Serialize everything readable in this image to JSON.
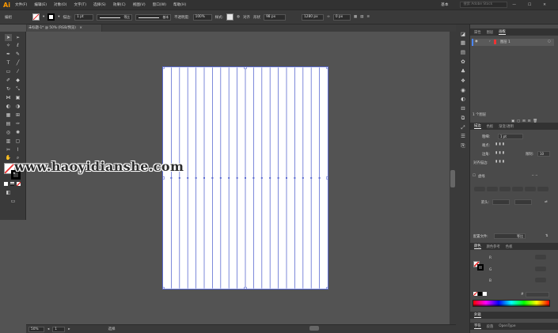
{
  "menubar": {
    "logo": "Ai",
    "items": [
      "文件(F)",
      "编辑(E)",
      "对象(O)",
      "文字(T)",
      "选择(S)",
      "效果(C)",
      "视图(V)",
      "窗口(W)",
      "帮助(H)"
    ],
    "workspace": "基本",
    "search_placeholder": "搜索 Adobe Stock",
    "window_controls": [
      "—",
      "☐",
      "✕"
    ]
  },
  "control_bar": {
    "object_label": "编组",
    "stroke_label": "描边:",
    "stroke_weight": "1 pt",
    "stroke_style": "等比",
    "brush": "基本",
    "opacity_label": "不透明度:",
    "opacity_value": "100%",
    "style_label": "样式:",
    "align_label": "对齐",
    "transform_label": "形状",
    "x_value": "98 px",
    "w_value": "1280 px",
    "angle_value": "0 px"
  },
  "document_tab": {
    "title": "未标题-1* @ 50% (RGB/预览)",
    "close": "×"
  },
  "status_bar": {
    "zoom": "50%",
    "page": "1",
    "tool": "选择"
  },
  "watermark": {
    "text": "www.haoyidianshe.com"
  },
  "artboard": {
    "line_count": 20
  },
  "layers_panel": {
    "tabs": [
      "属性",
      "图层",
      "画板"
    ],
    "active_tab": "画板",
    "rows": [
      {
        "name": "图层 1"
      }
    ],
    "footer": "1 个图层"
  },
  "stroke_panel": {
    "tabs": [
      "描边",
      "色板",
      "渐变/透明"
    ],
    "weight_label": "粗细:",
    "weight_value": "1 pt",
    "cap_label": "端点:",
    "corner_label": "边角:",
    "limit_label": "限制:",
    "limit_value": "10",
    "align_label": "对齐描边:",
    "dashed_label": "虚线",
    "arrow_label": "箭头:",
    "profile_label": "配置文件:",
    "profile_value": "等比"
  },
  "color_panel": {
    "tabs": [
      "颜色",
      "颜色参考",
      "色板"
    ],
    "channels": [
      "R",
      "G",
      "B"
    ],
    "hex_label": "#"
  },
  "bottom_panels": {
    "appearance": "外观",
    "tabs": [
      "字符",
      "段落",
      "OpenType"
    ]
  },
  "colors": {
    "menubar": "#323232",
    "canvas": "#535353",
    "artboard_lines": "#5c6bd1",
    "accent": "#ff9a00"
  }
}
